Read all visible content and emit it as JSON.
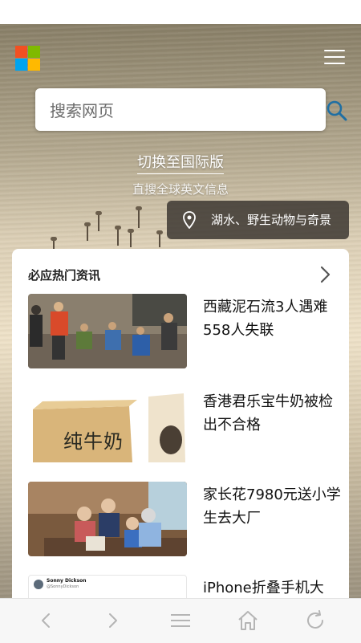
{
  "header": {
    "logo": "microsoft-logo",
    "logo_colors": [
      "#f25022",
      "#7fba00",
      "#00a4ef",
      "#ffb900"
    ],
    "menu_icon": "hamburger-icon"
  },
  "search": {
    "placeholder": "搜索网页",
    "icon": "search-icon",
    "accent_color": "#1f6fa3"
  },
  "international": {
    "link": "切换至国际版",
    "subtitle": "直搜全球英文信息"
  },
  "image_caption": {
    "icon": "location-pin-icon",
    "text": "湖水、野生动物与奇景"
  },
  "news": {
    "title": "必应热门资讯",
    "more_icon": "chevron-right-icon",
    "items": [
      {
        "headline": "西藏泥石流3人遇难558人失联"
      },
      {
        "headline": "香港君乐宝牛奶被检出不合格",
        "thumb_text": "纯牛奶"
      },
      {
        "headline": "家长花7980元送小学生去大厂"
      },
      {
        "headline": "iPhone折叠手机大",
        "thumb_author": "Sonny Dickson",
        "thumb_handle": "@SonnyDickson"
      }
    ]
  },
  "bottom_nav": {
    "buttons": [
      "back-icon",
      "forward-icon",
      "menu-icon",
      "home-icon",
      "refresh-icon"
    ]
  }
}
